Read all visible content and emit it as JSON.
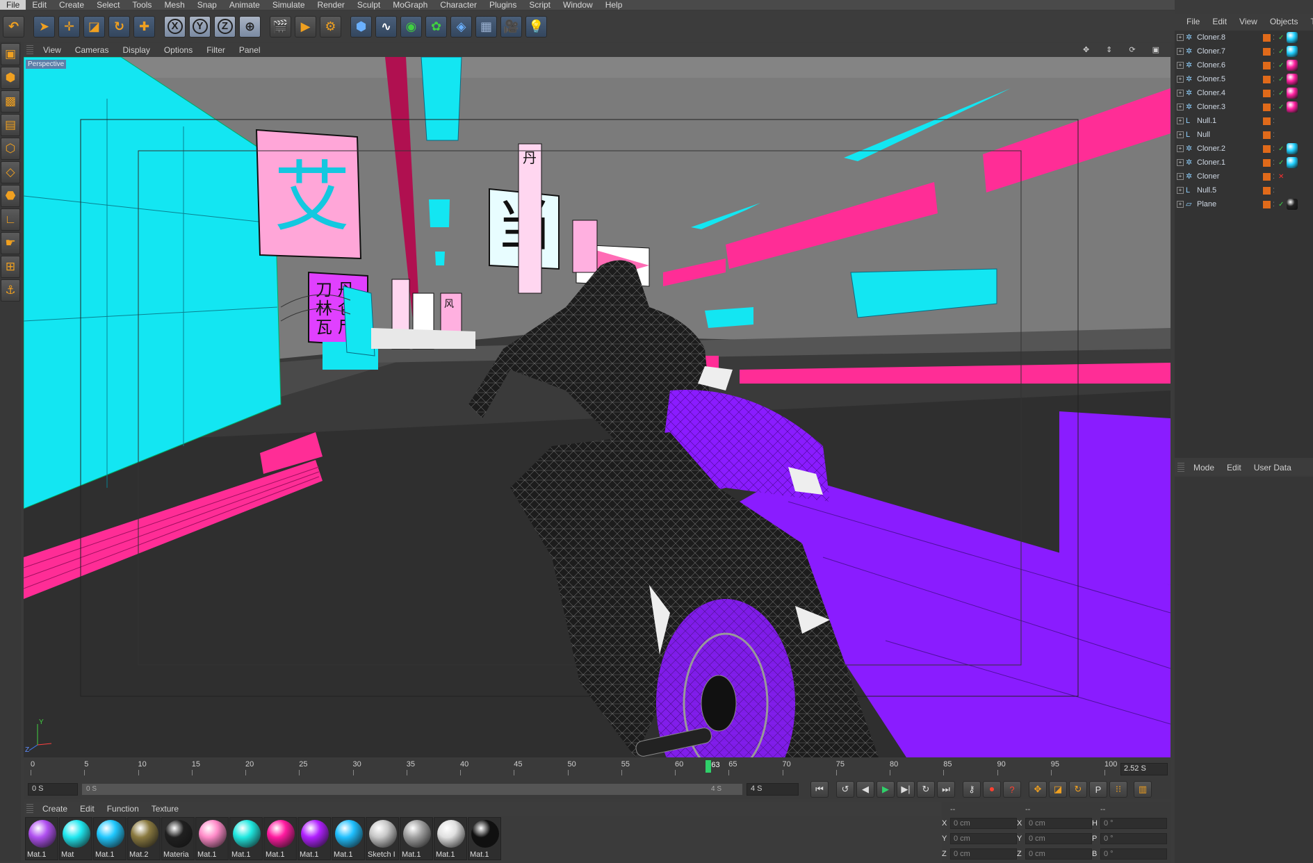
{
  "menubar": [
    "File",
    "Edit",
    "Create",
    "Select",
    "Tools",
    "Mesh",
    "Snap",
    "Animate",
    "Simulate",
    "Render",
    "Sculpt",
    "MoGraph",
    "Character",
    "Plugins",
    "Script",
    "Window",
    "Help"
  ],
  "toolbar": {
    "axis_x": "X",
    "axis_y": "Y",
    "axis_z": "Z"
  },
  "viewport": {
    "menu": [
      "View",
      "Cameras",
      "Display",
      "Options",
      "Filter",
      "Panel"
    ],
    "label": "Perspective",
    "signs": [
      "艾",
      "当",
      "丹",
      "刀 丹",
      "林 仑",
      "瓦 尸",
      "风"
    ],
    "axis_y": "Y",
    "axis_z": "Z"
  },
  "timeline": {
    "ticks": [
      "0",
      "5",
      "10",
      "15",
      "20",
      "25",
      "30",
      "35",
      "40",
      "45",
      "50",
      "55",
      "60",
      "65",
      "70",
      "75",
      "80",
      "85",
      "90",
      "95",
      "100"
    ],
    "current_frame": "63",
    "current_time": "2.52 S",
    "progress": 0.63
  },
  "transport": {
    "start": "0 S",
    "range_start": "0 S",
    "range_end": "4 S",
    "end": "4 S"
  },
  "material_manager": {
    "menu": [
      "Create",
      "Edit",
      "Function",
      "Texture"
    ],
    "materials": [
      {
        "label": "Mat.1",
        "color": "#b050f0"
      },
      {
        "label": "Mat",
        "color": "#20e8f0"
      },
      {
        "label": "Mat.1",
        "color": "#20c8ff"
      },
      {
        "label": "Mat.2",
        "color": "#8a7a40"
      },
      {
        "label": "Materia",
        "color": "#202020"
      },
      {
        "label": "Mat.1",
        "color": "#ff8ac8"
      },
      {
        "label": "Mat.1",
        "color": "#20e8e0"
      },
      {
        "label": "Mat.1",
        "color": "#ff1aa0"
      },
      {
        "label": "Mat.1",
        "color": "#b020ff"
      },
      {
        "label": "Mat.1",
        "color": "#20c0ff"
      },
      {
        "label": "Sketch I",
        "color": "#c8c8c8"
      },
      {
        "label": "Mat.1",
        "color": "#a0a0a0"
      },
      {
        "label": "Mat.1",
        "color": "#e0e0e0"
      },
      {
        "label": "Mat.1",
        "color": "#101010"
      }
    ]
  },
  "coordinates": {
    "header": [
      "--",
      "--",
      "--"
    ],
    "rows": [
      {
        "a": "X",
        "av": "0 cm",
        "b": "X",
        "bv": "0 cm",
        "c": "H",
        "cv": "0 °"
      },
      {
        "a": "Y",
        "av": "0 cm",
        "b": "Y",
        "bv": "0 cm",
        "c": "P",
        "cv": "0 °"
      },
      {
        "a": "Z",
        "av": "0 cm",
        "b": "Z",
        "bv": "0 cm",
        "c": "B",
        "cv": "0 °"
      }
    ]
  },
  "object_manager": {
    "menu": [
      "File",
      "Edit",
      "View",
      "Objects",
      "Ta"
    ],
    "objects": [
      {
        "name": "Cloner.8",
        "icon": "cloner",
        "tex": "#20d0ff",
        "check": true
      },
      {
        "name": "Cloner.7",
        "icon": "cloner",
        "tex": "#20d0ff",
        "check": true
      },
      {
        "name": "Cloner.6",
        "icon": "cloner",
        "tex": "#ff20a0",
        "check": true
      },
      {
        "name": "Cloner.5",
        "icon": "cloner",
        "tex": "#ff20a0",
        "check": true
      },
      {
        "name": "Cloner.4",
        "icon": "cloner",
        "tex": "#ff20a0",
        "check": true
      },
      {
        "name": "Cloner.3",
        "icon": "cloner",
        "tex": "#ff20a0",
        "check": true
      },
      {
        "name": "Null.1",
        "icon": "null",
        "tex": "",
        "check": false
      },
      {
        "name": "Null",
        "icon": "null",
        "tex": "",
        "check": false
      },
      {
        "name": "Cloner.2",
        "icon": "cloner",
        "tex": "#20d0ff",
        "check": true
      },
      {
        "name": "Cloner.1",
        "icon": "cloner",
        "tex": "#20d0ff",
        "check": true
      },
      {
        "name": "Cloner",
        "icon": "cloner",
        "tex": "",
        "check": false
      },
      {
        "name": "Null.5",
        "icon": "null",
        "tex": "",
        "check": false
      },
      {
        "name": "Plane",
        "icon": "plane",
        "tex": "#222222",
        "check": true
      }
    ]
  },
  "attribute_manager": {
    "menu": [
      "Mode",
      "Edit",
      "User Data"
    ]
  },
  "colors": {
    "cyan": "#13e6f2",
    "pink": "#ff2d96",
    "purple": "#8a1cff",
    "light_pink": "#ffb0e0"
  }
}
